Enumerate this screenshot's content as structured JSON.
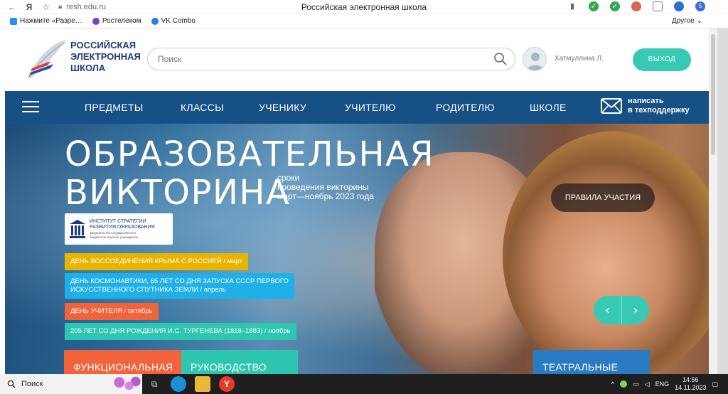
{
  "browser": {
    "url": "resh.edu.ru",
    "page_title": "Российская электронная школа",
    "bookmarks": [
      "Нажмите «Разре…",
      "Ростелеком",
      "VK Combo"
    ],
    "other_bookmarks": "Другое",
    "badge_count": "5"
  },
  "header": {
    "logo_lines": [
      "РОССИЙСКАЯ",
      "ЭЛЕКТРОННАЯ",
      "ШКОЛА"
    ],
    "search_placeholder": "Поиск",
    "user_name": "Хатмуллина Л.",
    "logout_label": "ВЫХОД"
  },
  "nav": {
    "items": [
      "ПРЕДМЕТЫ",
      "КЛАССЫ",
      "УЧЕНИКУ",
      "УЧИТЕЛЮ",
      "РОДИТЕЛЮ",
      "ШКОЛЕ"
    ],
    "support_line1": "написать",
    "support_line2": "в техподдержку"
  },
  "hero": {
    "title_line1": "ОБРАЗОВАТЕЛЬНАЯ",
    "title_line2": "ВИКТОРИНА",
    "dates_line1": "сроки",
    "dates_line2": "проведения викторины",
    "dates_line3": "март—ноябрь 2023 года",
    "rules_label": "ПРАВИЛА УЧАСТИЯ",
    "institute_line1": "ИНСТИТУТ СТРАТЕГИИ",
    "institute_line2": "РАЗВИТИЯ ОБРАЗОВАНИЯ",
    "institute_small1": "федеральное государственное",
    "institute_small2": "бюджетное научное учреждение",
    "tags": [
      {
        "text": "ДЕНЬ ВОССОЕДИНЕНИЯ КРЫМА С РОССИЕЙ / март",
        "color": "#e8b400"
      },
      {
        "text1": "ДЕНЬ КОСМОНАВТИКИ, 65 ЛЕТ СО ДНЯ ЗАПУСКА СССР ПЕРВОГО",
        "text2": "ИСКУССТВЕННОГО СПУТНИКА ЗЕМЛИ / апрель",
        "color": "#1fb0e8"
      },
      {
        "text": "ДЕНЬ УЧИТЕЛЯ / октябрь",
        "color": "#f2623b"
      },
      {
        "text": "205 ЛЕТ СО ДНЯ РОЖДЕНИЯ И.С. ТУРГЕНЕВА (1818–1883) / ноябрь",
        "color": "#2ec6b0"
      }
    ],
    "cards": [
      "ФУНКЦИОНАЛЬНАЯ",
      "РУКОВОДСТВО",
      "ТЕАТРАЛЬНЫЕ"
    ]
  },
  "taskbar": {
    "search_label": "Поиск",
    "lang": "ENG",
    "time": "14:56",
    "date": "14.11.2023"
  },
  "colors": {
    "brand_blue": "#165085",
    "accent_teal": "#38c9b4"
  }
}
